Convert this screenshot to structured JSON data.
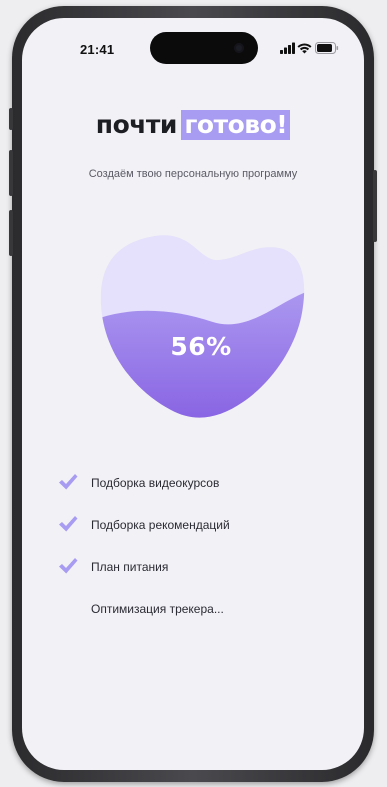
{
  "status_bar": {
    "time": "21:41"
  },
  "header": {
    "title_plain": "почти",
    "title_highlight": "готово!",
    "subtitle": "Создаём твою персональную программу"
  },
  "progress": {
    "value_percent": 56,
    "label": "56%"
  },
  "tasks": [
    {
      "label": "Подборка видеокурсов",
      "done": true
    },
    {
      "label": "Подборка рекомендаций",
      "done": true
    },
    {
      "label": "План питания",
      "done": true
    },
    {
      "label": "Оптимизация трекера...",
      "done": false
    }
  ],
  "colors": {
    "accent": "#a79bf2",
    "heart_light": "#e5e0fb",
    "heart_fill_top": "#a995ef",
    "heart_fill_bottom": "#8a67e4",
    "check": "#a79bf2",
    "background": "#f2f1f5"
  },
  "icons": {
    "signal": "cellular-signal-icon",
    "wifi": "wifi-icon",
    "battery": "battery-icon",
    "check": "checkmark-icon"
  }
}
